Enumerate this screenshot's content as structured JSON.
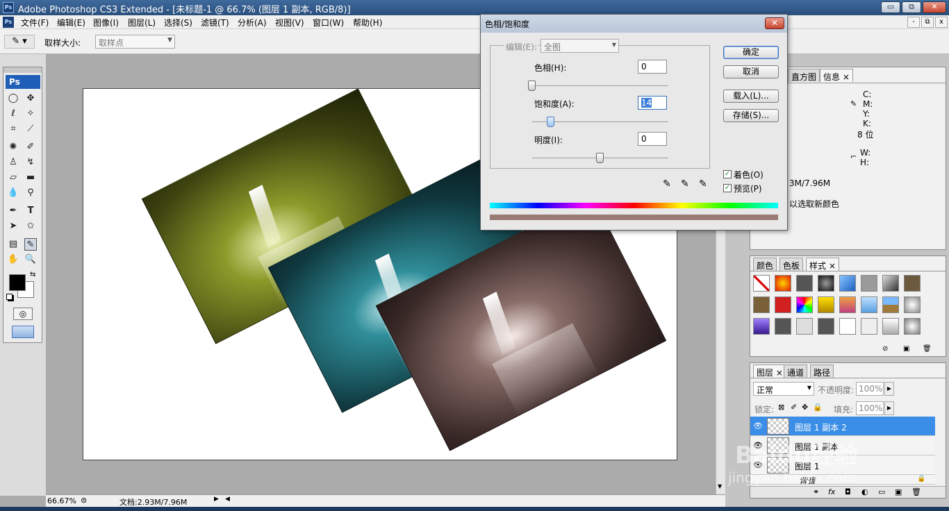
{
  "app": {
    "logo": "Ps",
    "window_title": "Adobe Photoshop CS3 Extended - [未标题-1 @ 66.7% (图层 1 副本, RGB/8)]",
    "window_buttons": [
      "▭",
      "⧉",
      "✕"
    ]
  },
  "menu": {
    "items": [
      "文件(F)",
      "编辑(E)",
      "图像(I)",
      "图层(L)",
      "选择(S)",
      "滤镜(T)",
      "分析(A)",
      "视图(V)",
      "窗口(W)",
      "帮助(H)"
    ],
    "doc_buttons": [
      "-",
      "⧉",
      "x"
    ]
  },
  "options": {
    "sample_size_label": "取样大小:",
    "sample_size_value": "取样点"
  },
  "status": {
    "zoom": "66.67%",
    "doc_info": "文档:2.93M/7.96M"
  },
  "dialog": {
    "title": "色相/饱和度",
    "edit_label": "编辑(E):",
    "edit_value": "全图",
    "hue_label": "色相(H):",
    "hue_value": "0",
    "saturation_label": "饱和度(A):",
    "saturation_value": "14",
    "lightness_label": "明度(I):",
    "lightness_value": "0",
    "hue_level": 0.0,
    "saturation_level": 0.14,
    "lightness_level": 0.5,
    "buttons": {
      "ok": "确定",
      "cancel": "取消",
      "load": "载入(L)...",
      "save": "存储(S)..."
    },
    "colorize_label": "着色(O)",
    "colorize_checked": true,
    "preview_label": "预览(P)",
    "preview_checked": true,
    "result_color": "#9a7c74"
  },
  "info_panel": {
    "tabs": [
      "直方图",
      "信息"
    ],
    "cmyk_labels": [
      "C:",
      "M:",
      "Y:",
      "K:"
    ],
    "bit_depth": "8 位",
    "wh_labels": [
      "W:",
      "H:"
    ],
    "doc_size": "3M/7.96M",
    "hint": "以选取新颜色"
  },
  "styles_panel": {
    "tabs": [
      "颜色",
      "色板",
      "样式"
    ]
  },
  "layers_panel": {
    "tabs": [
      "图层",
      "通道",
      "路径"
    ],
    "blend_mode": "正常",
    "opacity_label": "不透明度:",
    "opacity_value": "100%",
    "lock_label": "锁定:",
    "fill_label": "填充:",
    "fill_value": "100%",
    "layers": [
      {
        "name": "图层 1 副本 2",
        "selected": true
      },
      {
        "name": "图层 1 副本",
        "selected": false
      },
      {
        "name": "图层 1",
        "selected": false
      },
      {
        "name": "背景",
        "selected": false
      }
    ]
  },
  "watermark": {
    "brand": "Baidu经验",
    "url": "jingyan.baidu.com"
  },
  "photos": [
    {
      "tint": "yellow-green",
      "color": "#8c9a2a"
    },
    {
      "tint": "cyan",
      "color": "#2f8e9a"
    },
    {
      "tint": "rose",
      "color": "#8a6e6a"
    }
  ]
}
